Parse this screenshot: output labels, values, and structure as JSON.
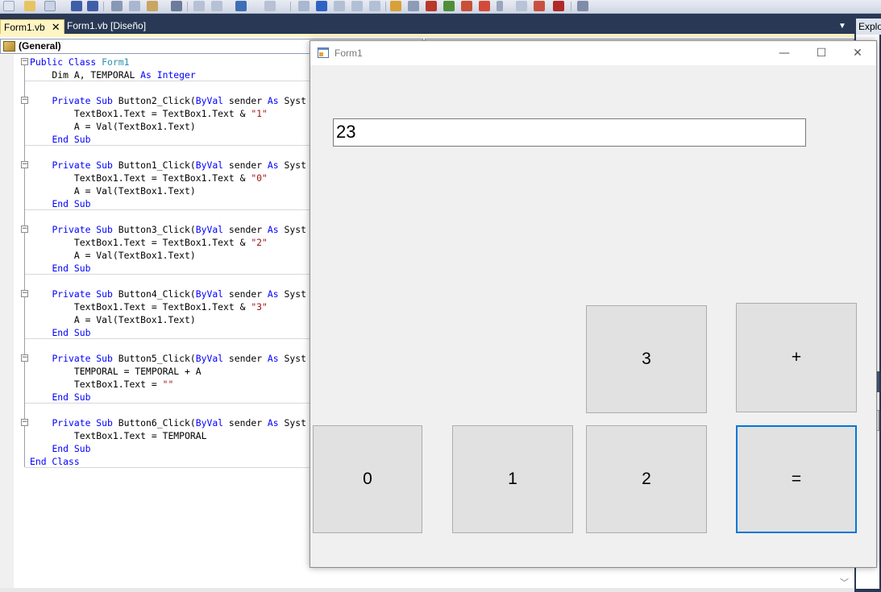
{
  "ide": {
    "tabs": [
      {
        "label": "Form1.vb",
        "close": "✕"
      },
      {
        "label": "Form1.vb [Diseño]"
      }
    ],
    "right_panel_title": "Explo",
    "general_combo": "(General)",
    "code_lines": [
      [
        [
          "kw",
          "Public Class "
        ],
        [
          "ty",
          "Form1"
        ]
      ],
      [
        [
          "",
          "    Dim A, TEMPORAL "
        ],
        [
          "kw",
          "As Integer"
        ]
      ],
      [
        [
          "",
          ""
        ]
      ],
      [
        [
          "",
          "    "
        ],
        [
          "kw",
          "Private Sub "
        ],
        [
          "",
          "Button2_Click("
        ],
        [
          "kw",
          "ByVal"
        ],
        [
          "",
          " sender "
        ],
        [
          "kw",
          "As"
        ],
        [
          "",
          " Syst"
        ]
      ],
      [
        [
          "",
          "        TextBox1.Text = TextBox1.Text & "
        ],
        [
          "st",
          "\"1\""
        ]
      ],
      [
        [
          "",
          "        A = Val(TextBox1.Text)"
        ]
      ],
      [
        [
          "",
          "    "
        ],
        [
          "kw",
          "End Sub"
        ]
      ],
      [
        [
          "",
          ""
        ]
      ],
      [
        [
          "",
          "    "
        ],
        [
          "kw",
          "Private Sub "
        ],
        [
          "",
          "Button1_Click("
        ],
        [
          "kw",
          "ByVal"
        ],
        [
          "",
          " sender "
        ],
        [
          "kw",
          "As"
        ],
        [
          "",
          " Syst"
        ]
      ],
      [
        [
          "",
          "        TextBox1.Text = TextBox1.Text & "
        ],
        [
          "st",
          "\"0\""
        ]
      ],
      [
        [
          "",
          "        A = Val(TextBox1.Text)"
        ]
      ],
      [
        [
          "",
          "    "
        ],
        [
          "kw",
          "End Sub"
        ]
      ],
      [
        [
          "",
          ""
        ]
      ],
      [
        [
          "",
          "    "
        ],
        [
          "kw",
          "Private Sub "
        ],
        [
          "",
          "Button3_Click("
        ],
        [
          "kw",
          "ByVal"
        ],
        [
          "",
          " sender "
        ],
        [
          "kw",
          "As"
        ],
        [
          "",
          " Syst"
        ]
      ],
      [
        [
          "",
          "        TextBox1.Text = TextBox1.Text & "
        ],
        [
          "st",
          "\"2\""
        ]
      ],
      [
        [
          "",
          "        A = Val(TextBox1.Text)"
        ]
      ],
      [
        [
          "",
          "    "
        ],
        [
          "kw",
          "End Sub"
        ]
      ],
      [
        [
          "",
          ""
        ]
      ],
      [
        [
          "",
          "    "
        ],
        [
          "kw",
          "Private Sub "
        ],
        [
          "",
          "Button4_Click("
        ],
        [
          "kw",
          "ByVal"
        ],
        [
          "",
          " sender "
        ],
        [
          "kw",
          "As"
        ],
        [
          "",
          " Syst"
        ]
      ],
      [
        [
          "",
          "        TextBox1.Text = TextBox1.Text & "
        ],
        [
          "st",
          "\"3\""
        ]
      ],
      [
        [
          "",
          "        A = Val(TextBox1.Text)"
        ]
      ],
      [
        [
          "",
          "    "
        ],
        [
          "kw",
          "End Sub"
        ]
      ],
      [
        [
          "",
          ""
        ]
      ],
      [
        [
          "",
          "    "
        ],
        [
          "kw",
          "Private Sub "
        ],
        [
          "",
          "Button5_Click("
        ],
        [
          "kw",
          "ByVal"
        ],
        [
          "",
          " sender "
        ],
        [
          "kw",
          "As"
        ],
        [
          "",
          " Syst"
        ]
      ],
      [
        [
          "",
          "        TEMPORAL = TEMPORAL + A"
        ]
      ],
      [
        [
          "",
          "        TextBox1.Text = "
        ],
        [
          "st",
          "\"\""
        ]
      ],
      [
        [
          "",
          "    "
        ],
        [
          "kw",
          "End Sub"
        ]
      ],
      [
        [
          "",
          ""
        ]
      ],
      [
        [
          "",
          "    "
        ],
        [
          "kw",
          "Private Sub "
        ],
        [
          "",
          "Button6_Click("
        ],
        [
          "kw",
          "ByVal"
        ],
        [
          "",
          " sender "
        ],
        [
          "kw",
          "As"
        ],
        [
          "",
          " Syst"
        ]
      ],
      [
        [
          "",
          "        TextBox1.Text = TEMPORAL"
        ]
      ],
      [
        [
          "",
          "    "
        ],
        [
          "kw",
          "End Sub"
        ]
      ],
      [
        [
          "kw",
          "End Class"
        ]
      ]
    ]
  },
  "form": {
    "title": "Form1",
    "minimize": "—",
    "maximize": "☐",
    "close": "✕",
    "display_value": "23",
    "buttons": {
      "b3": "3",
      "plus": "+",
      "b0": "0",
      "b1": "1",
      "b2": "2",
      "equals": "="
    }
  },
  "colors": {
    "accent": "#0078d7",
    "keyword": "#0000ff",
    "type": "#2b91af",
    "string": "#a31515",
    "ide_chrome": "#293955"
  }
}
